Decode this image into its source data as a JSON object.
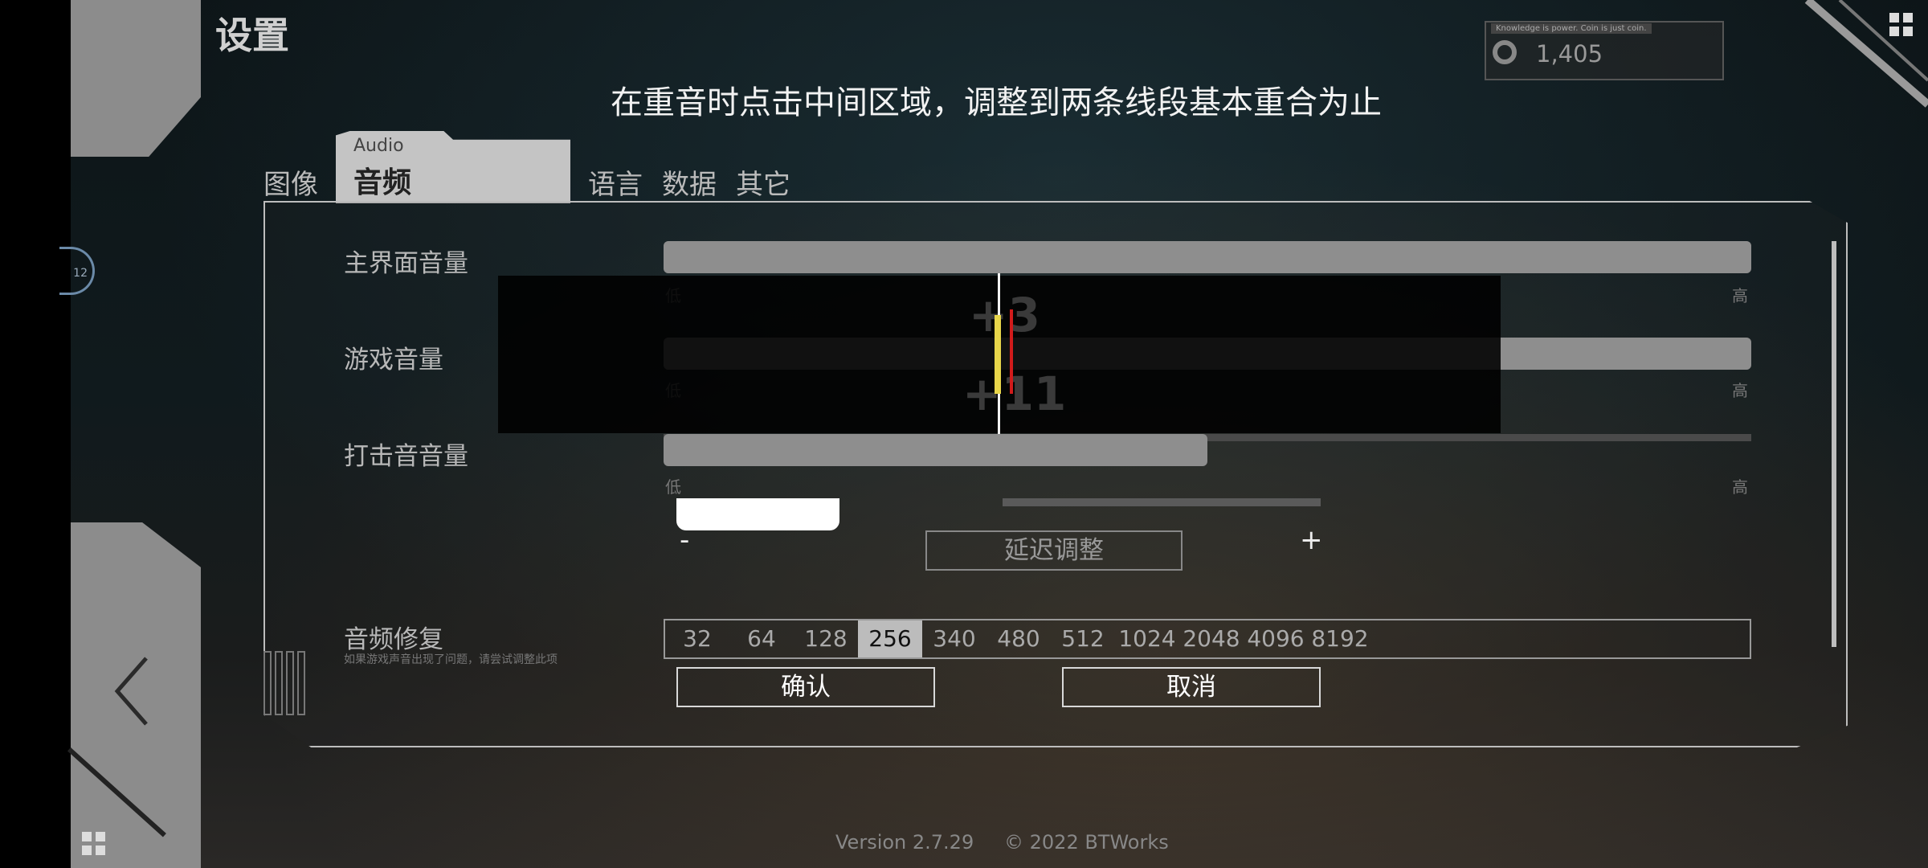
{
  "header": {
    "title": "设置",
    "coin_tagline": "Knowledge is power. Coin is just coin.",
    "coin_value": "1,405",
    "badge_number": "12"
  },
  "hint": "在重音时点击中间区域，调整到两条线段基本重合为止",
  "tabs": [
    {
      "label": "图像"
    },
    {
      "label": "音频",
      "sub": "Audio"
    },
    {
      "label": "语言"
    },
    {
      "label": "数据"
    },
    {
      "label": "其它"
    }
  ],
  "settings": {
    "main_volume": {
      "label": "主界面音量",
      "low": "低",
      "high": "高",
      "value": 1.0
    },
    "game_volume": {
      "label": "游戏音量",
      "low": "低",
      "high": "高",
      "value": 1.0
    },
    "hit_volume": {
      "label": "打击音音量",
      "low": "低",
      "high": "高",
      "value": 0.5
    }
  },
  "calibration": {
    "offset_top": "+3",
    "offset_bottom": "+11",
    "minus": "-",
    "plus": "+",
    "delay_button": "延迟调整",
    "delay_fill": 0.5
  },
  "audio_fix": {
    "label": "音频修复",
    "note": "如果游戏声音出现了问题，请尝试调整此项",
    "options": [
      "32",
      "64",
      "128",
      "256",
      "340",
      "480",
      "512",
      "1024",
      "2048",
      "4096",
      "8192"
    ],
    "selected": "256"
  },
  "buttons": {
    "confirm": "确认",
    "cancel": "取消"
  },
  "footer": {
    "version": "Version 2.7.29",
    "copyright": "© 2022 BTWorks"
  },
  "colors": {
    "highlight_yellow": "#e8d64a",
    "highlight_red": "#d11b1b"
  }
}
